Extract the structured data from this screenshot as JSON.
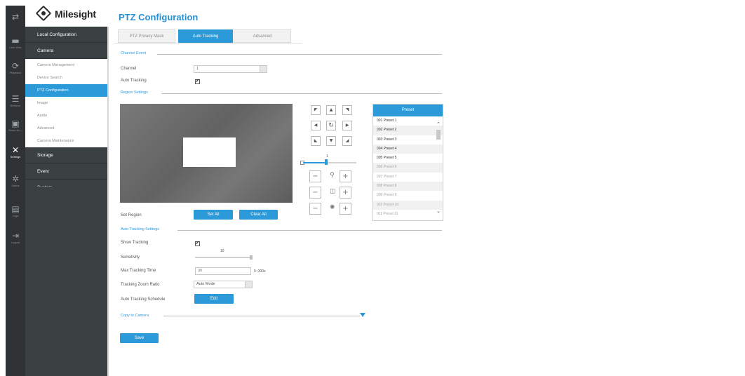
{
  "rail": [
    {
      "icon": "preview-icon",
      "glyph": "⇄",
      "label": ""
    },
    {
      "icon": "live-view-icon",
      "glyph": "▬",
      "label": "Live View"
    },
    {
      "icon": "playback-icon",
      "glyph": "⟳",
      "label": "Playback"
    },
    {
      "icon": "retrieve-icon",
      "glyph": "☰",
      "label": "Retrieve"
    },
    {
      "icon": "smart-analysis-icon",
      "glyph": "▣",
      "label": "Smart An..."
    },
    {
      "icon": "settings-icon",
      "glyph": "✕",
      "label": "Settings"
    },
    {
      "icon": "status-icon",
      "glyph": "✲",
      "label": "Status"
    },
    {
      "icon": "logs-icon",
      "glyph": "▤",
      "label": "Logs"
    },
    {
      "icon": "logout-icon",
      "glyph": "⇥",
      "label": "Logout"
    }
  ],
  "logo": {
    "text": "Milesight"
  },
  "sidebar": {
    "local_configuration": "Local Configuration",
    "camera": "Camera",
    "camera_items": [
      "Camera Management",
      "Device Search",
      "PTZ Configuration",
      "Image",
      "Audio",
      "Advanced",
      "Camera Maintenance"
    ],
    "storage": "Storage",
    "event": "Event",
    "system": "System"
  },
  "page_title": "PTZ Configuration",
  "tabs": [
    "PTZ Privacy Mask",
    "Auto Tracking",
    "Advanced"
  ],
  "channel_event": {
    "title": "Channel Event",
    "channel_label": "Channel",
    "channel_value": "1",
    "auto_tracking_label": "Auto Tracking",
    "check": "✔"
  },
  "region_settings": {
    "title": "Region Settings",
    "set_region_label": "Set Region",
    "set_all": "Set All",
    "clear_all": "Clear All",
    "zoom_value": "1"
  },
  "presets": {
    "header": "Preset",
    "rows": [
      "001  Preset 1",
      "002  Preset 2",
      "003  Preset 3",
      "004  Preset 4",
      "005  Preset 5",
      "006  Preset 6",
      "007  Preset 7",
      "008  Preset 8",
      "009  Preset 9",
      "010  Preset 10",
      "011  Preset 11"
    ]
  },
  "auto_tracking_settings": {
    "title": "Auto Tracking Settings",
    "show_tracking_label": "Show Tracking",
    "sensitivity_label": "Sensitivity",
    "sensitivity_value": "10",
    "max_time_label": "Max Tracking Time",
    "max_time_value": "30",
    "max_time_hint": "5~300s",
    "zoom_ratio_label": "Tracking Zoom Ratio",
    "zoom_ratio_value": "Auto Mode",
    "schedule_label": "Auto Tracking Schedule",
    "edit": "Edit"
  },
  "copy_to_camera": "Copy to Camera",
  "save": "Save"
}
